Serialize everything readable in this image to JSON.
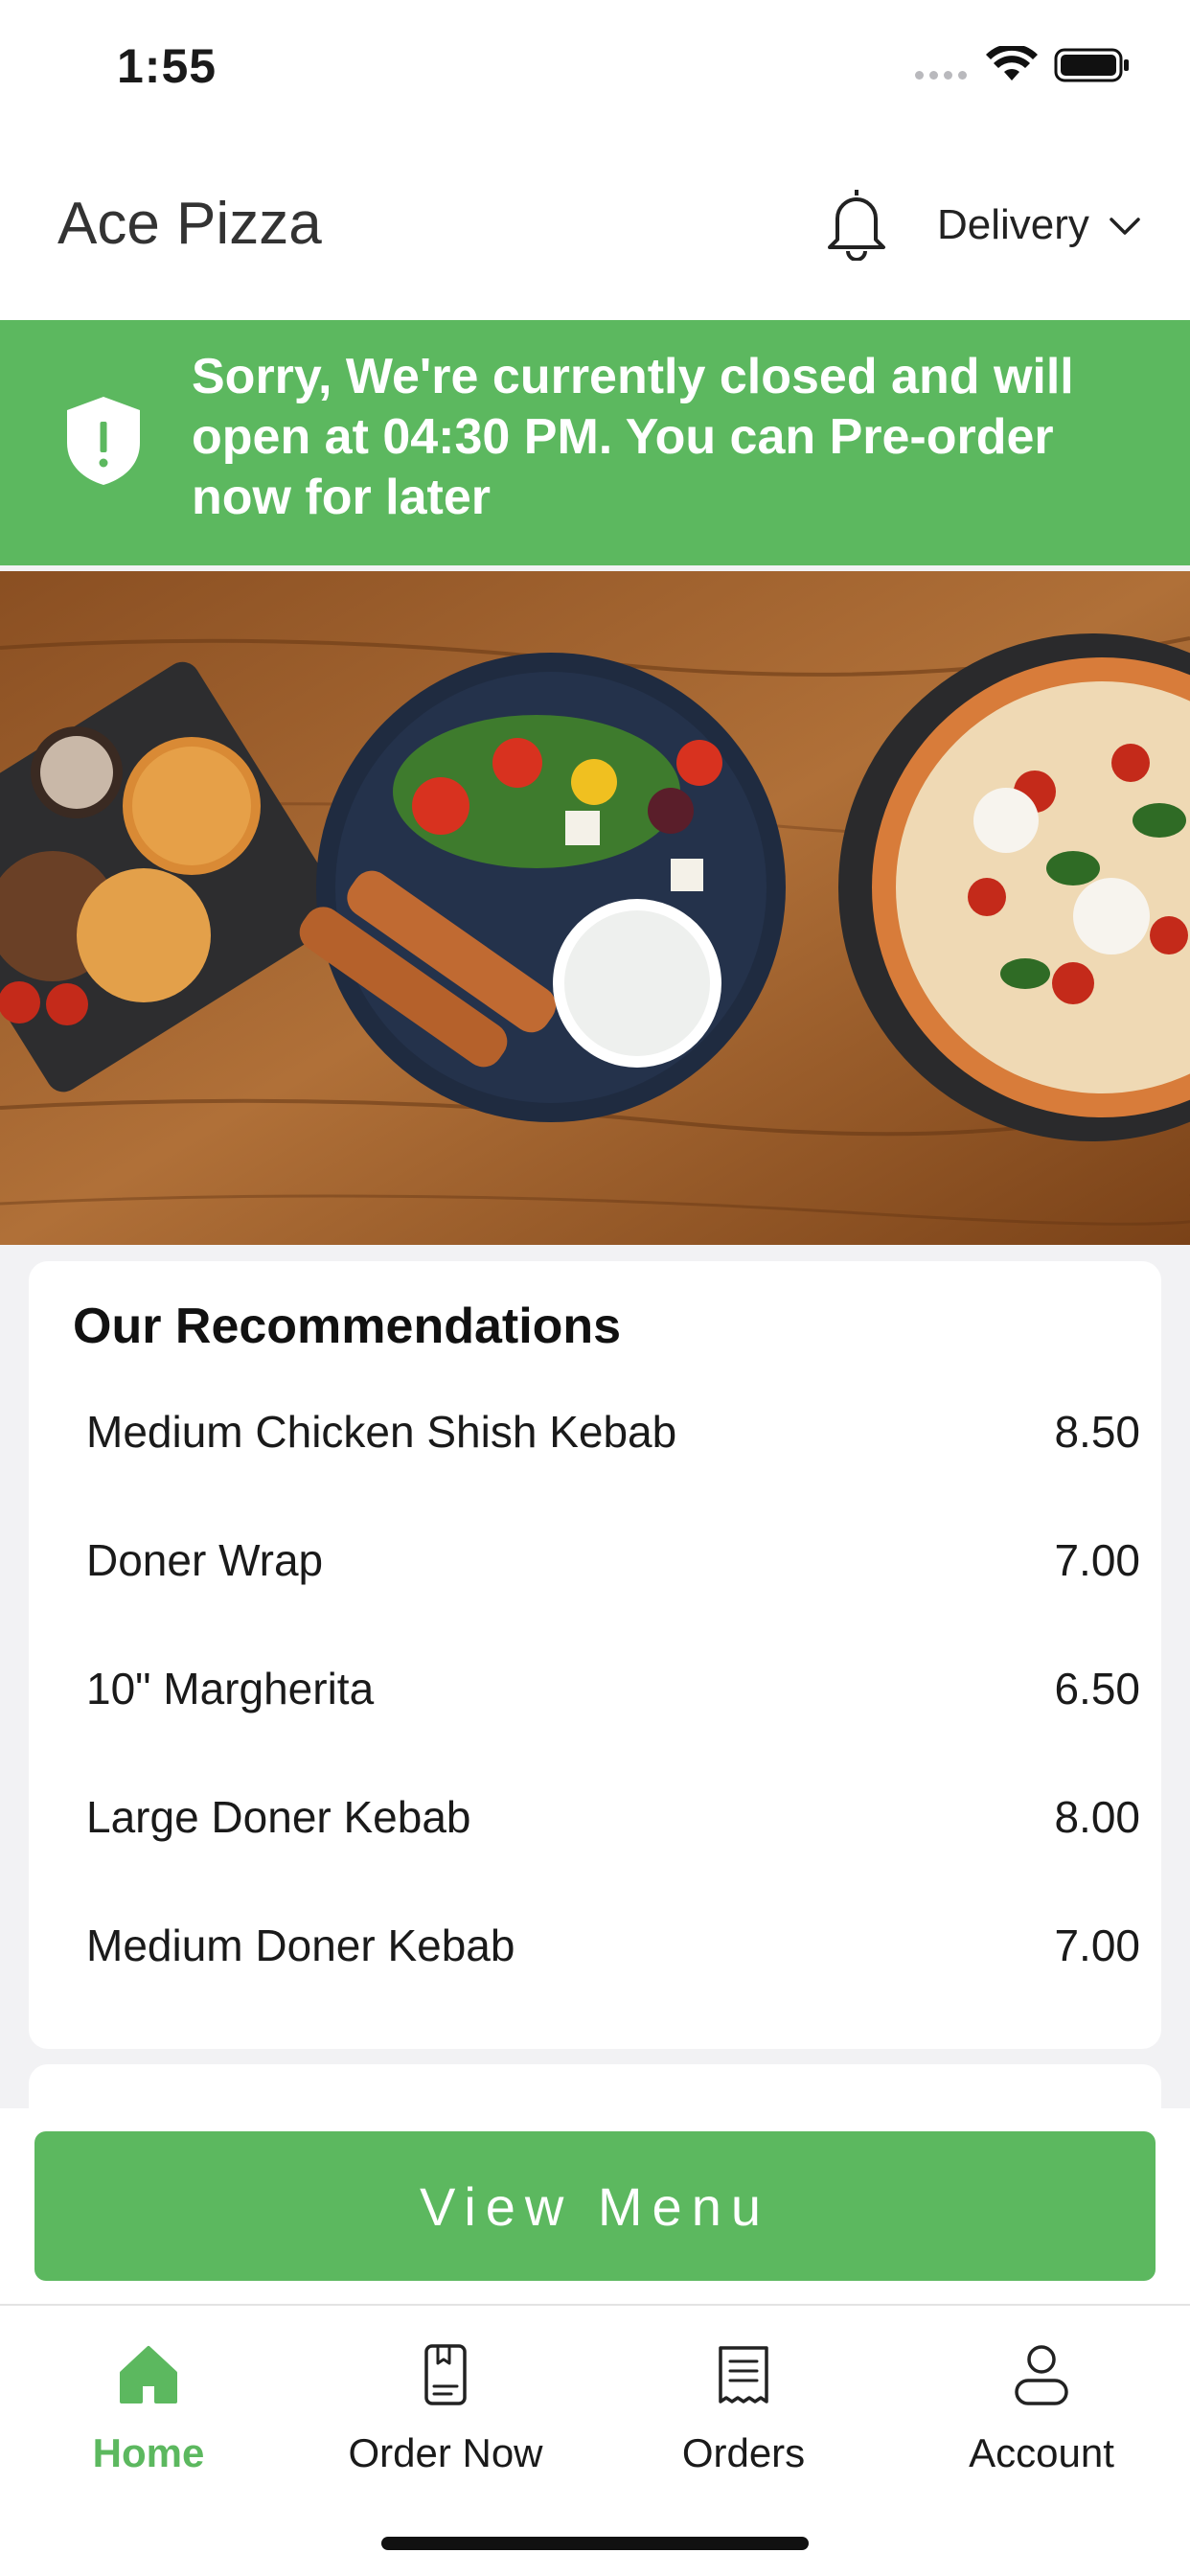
{
  "status_bar": {
    "time": "1:55"
  },
  "header": {
    "title": "Ace Pizza",
    "mode": "Delivery"
  },
  "banner": {
    "message": "Sorry, We're currently closed and will open at 04:30 PM. You can Pre-order now for later"
  },
  "recommendations": {
    "title": "Our Recommendations",
    "items": [
      {
        "name": "Medium Chicken Shish Kebab",
        "price": "8.50"
      },
      {
        "name": "Doner Wrap",
        "price": "7.00"
      },
      {
        "name": "10\" Margherita",
        "price": "6.50"
      },
      {
        "name": "Large Doner Kebab",
        "price": "8.00"
      },
      {
        "name": "Medium Doner Kebab",
        "price": "7.00"
      }
    ]
  },
  "cta": {
    "label": "View Menu"
  },
  "tabs": [
    {
      "label": "Home",
      "icon": "home-icon",
      "active": true
    },
    {
      "label": "Order Now",
      "icon": "menu-book-icon",
      "active": false
    },
    {
      "label": "Orders",
      "icon": "receipt-icon",
      "active": false
    },
    {
      "label": "Account",
      "icon": "user-icon",
      "active": false
    }
  ],
  "colors": {
    "accent": "#5cb85f",
    "text": "#1a1a1a",
    "background": "#f2f2f4"
  }
}
